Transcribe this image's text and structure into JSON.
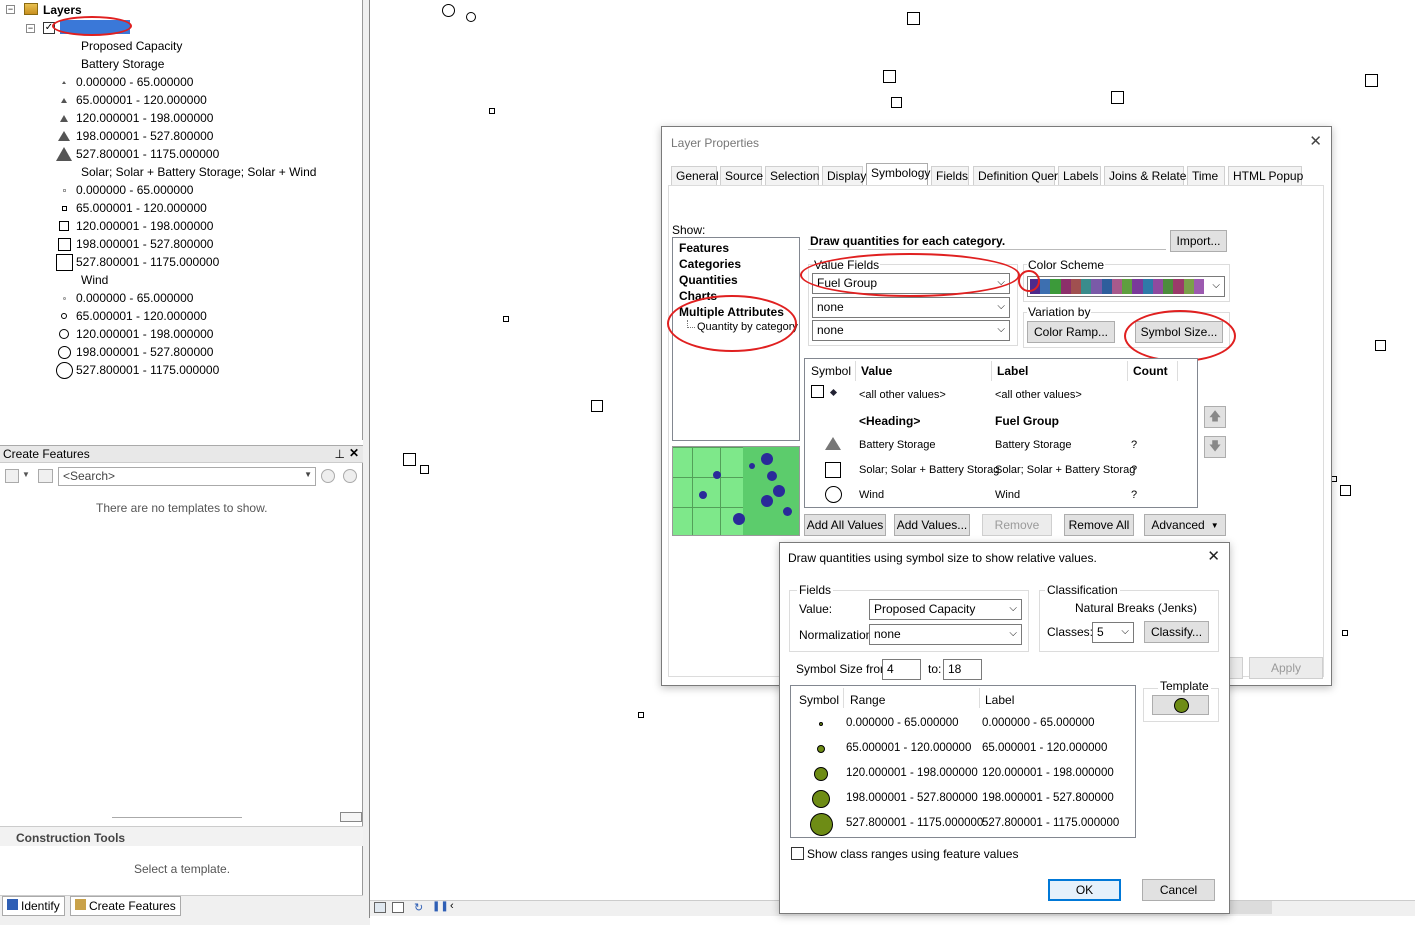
{
  "toc": {
    "title": "Layers",
    "layer_name": "(redacted layer)",
    "field_header": "Proposed Capacity",
    "groups": [
      {
        "name": "Battery Storage",
        "shape": "triangle"
      },
      {
        "name": "Solar; Solar + Battery Storage; Solar + Wind",
        "shape": "square"
      },
      {
        "name": "Wind",
        "shape": "circle"
      }
    ],
    "ranges": [
      "0.000000 - 65.000000",
      "65.000001 - 120.000000",
      "120.000001 - 198.000000",
      "198.000001 - 527.800000",
      "527.800001 - 1175.000000"
    ]
  },
  "create_features": {
    "title": "Create Features",
    "search_placeholder": "<Search>",
    "empty_msg": "There are no templates to show.",
    "construction_title": "Construction Tools",
    "construction_msg": "Select a template.",
    "tabs": [
      "Identify",
      "Create Features"
    ]
  },
  "layer_props": {
    "title": "Layer Properties",
    "tabs": [
      "General",
      "Source",
      "Selection",
      "Display",
      "Symbology",
      "Fields",
      "Definition Query",
      "Labels",
      "Joins & Relates",
      "Time",
      "HTML Popup"
    ],
    "show_label": "Show:",
    "show_items": [
      "Features",
      "Categories",
      "Quantities",
      "Charts",
      "Multiple Attributes"
    ],
    "show_subitem": "Quantity by category",
    "heading": "Draw quantities for each category.",
    "import_btn": "Import...",
    "value_fields_label": "Value Fields",
    "value_field": "Fuel Group",
    "field2": "none",
    "field3": "none",
    "color_scheme_label": "Color Scheme",
    "color_scheme": [
      "#4d2a8c",
      "#3d6fb0",
      "#3c9a3a",
      "#8c2f6a",
      "#a05050",
      "#3a8c8c",
      "#7a5aa8",
      "#2e5e9c",
      "#a85a8c",
      "#5f9f3f",
      "#7a3a9a",
      "#2f7aa8",
      "#8f4a9f",
      "#4c8c3c",
      "#9a3a6a",
      "#7aa04a",
      "#9c5ab0"
    ],
    "variation_label": "Variation by",
    "color_ramp_btn": "Color Ramp...",
    "symbol_size_btn": "Symbol Size...",
    "table_headers": [
      "Symbol",
      "Value",
      "Label",
      "Count"
    ],
    "rows": [
      {
        "value": "<all other values>",
        "label": "<all other values>",
        "count": ""
      },
      {
        "value": "<Heading>",
        "label": "Fuel Group",
        "count": ""
      },
      {
        "value": "Battery Storage",
        "label": "Battery Storage",
        "count": "?"
      },
      {
        "value": "Solar; Solar + Battery Storag",
        "label": "Solar; Solar + Battery Storag",
        "count": "?"
      },
      {
        "value": "Wind",
        "label": "Wind",
        "count": "?"
      }
    ],
    "buttons": [
      "Add All Values",
      "Add Values...",
      "Remove",
      "Remove All",
      "Advanced"
    ],
    "apply_btn": "Apply"
  },
  "symbol_size_dlg": {
    "title": "Draw quantities using symbol size to show relative values.",
    "fields_label": "Fields",
    "value_label": "Value:",
    "value_field": "Proposed Capacity",
    "normalization_label": "Normalization:",
    "normalization": "none",
    "classification_label": "Classification",
    "method": "Natural Breaks (Jenks)",
    "classes_label": "Classes:",
    "classes": "5",
    "classify_btn": "Classify...",
    "size_from_label": "Symbol Size from:",
    "size_from": "4",
    "size_to_label": "to:",
    "size_to": "18",
    "table_headers": [
      "Symbol",
      "Range",
      "Label"
    ],
    "rows": [
      {
        "range": "0.000000 - 65.000000",
        "label": "0.000000 - 65.000000"
      },
      {
        "range": "65.000001 - 120.000000",
        "label": "65.000001 - 120.000000"
      },
      {
        "range": "120.000001 - 198.000000",
        "label": "120.000001 - 198.000000"
      },
      {
        "range": "198.000001 - 527.800000",
        "label": "198.000001 - 527.800000"
      },
      {
        "range": "527.800001 - 1175.000000",
        "label": "527.800001 - 1175.000000"
      }
    ],
    "template_label": "Template",
    "checkbox_label": "Show class ranges using feature values",
    "ok_btn": "OK",
    "cancel_btn": "Cancel",
    "symbol_color": "#6e8c15"
  }
}
